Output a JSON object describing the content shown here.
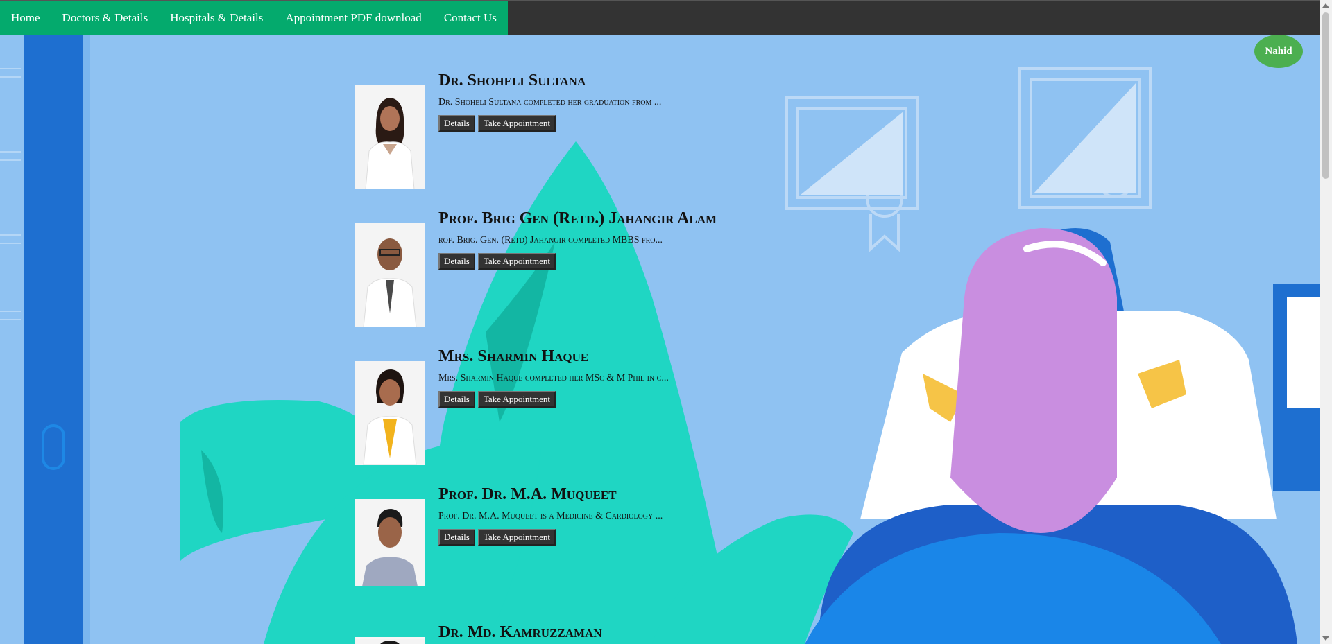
{
  "nav": {
    "items": [
      {
        "label": "Home"
      },
      {
        "label": "Doctors & Details"
      },
      {
        "label": "Hospitals & Details"
      },
      {
        "label": "Appointment PDF download"
      },
      {
        "label": "Contact Us"
      }
    ]
  },
  "user": {
    "name": "Nahid"
  },
  "buttons": {
    "details": "Details",
    "appointment": "Take Appointment"
  },
  "doctors": [
    {
      "name": "Dr. Shoheli Sultana",
      "desc": "Dr. Shoheli Sultana completed her graduation from ..."
    },
    {
      "name": "Prof. Brig Gen (Retd.) Jahangir Alam",
      "desc": "rof. Brig. Gen. (Retd) Jahangir completed MBBS fro..."
    },
    {
      "name": "Mrs. Sharmin Haque",
      "desc": "Mrs. Sharmin Haque completed her MSc & M Phil in c..."
    },
    {
      "name": "Prof. Dr. M.A. Muqueet",
      "desc": "Prof. Dr. M.A. Muqueet is a Medicine & Cardiology ..."
    },
    {
      "name": "Dr. Md. Kamruzzaman",
      "desc": ""
    }
  ],
  "colors": {
    "nav_green": "#04aa6d",
    "topbar": "#333333",
    "background": "#8fc2f2",
    "user_badge": "#4caf50"
  }
}
